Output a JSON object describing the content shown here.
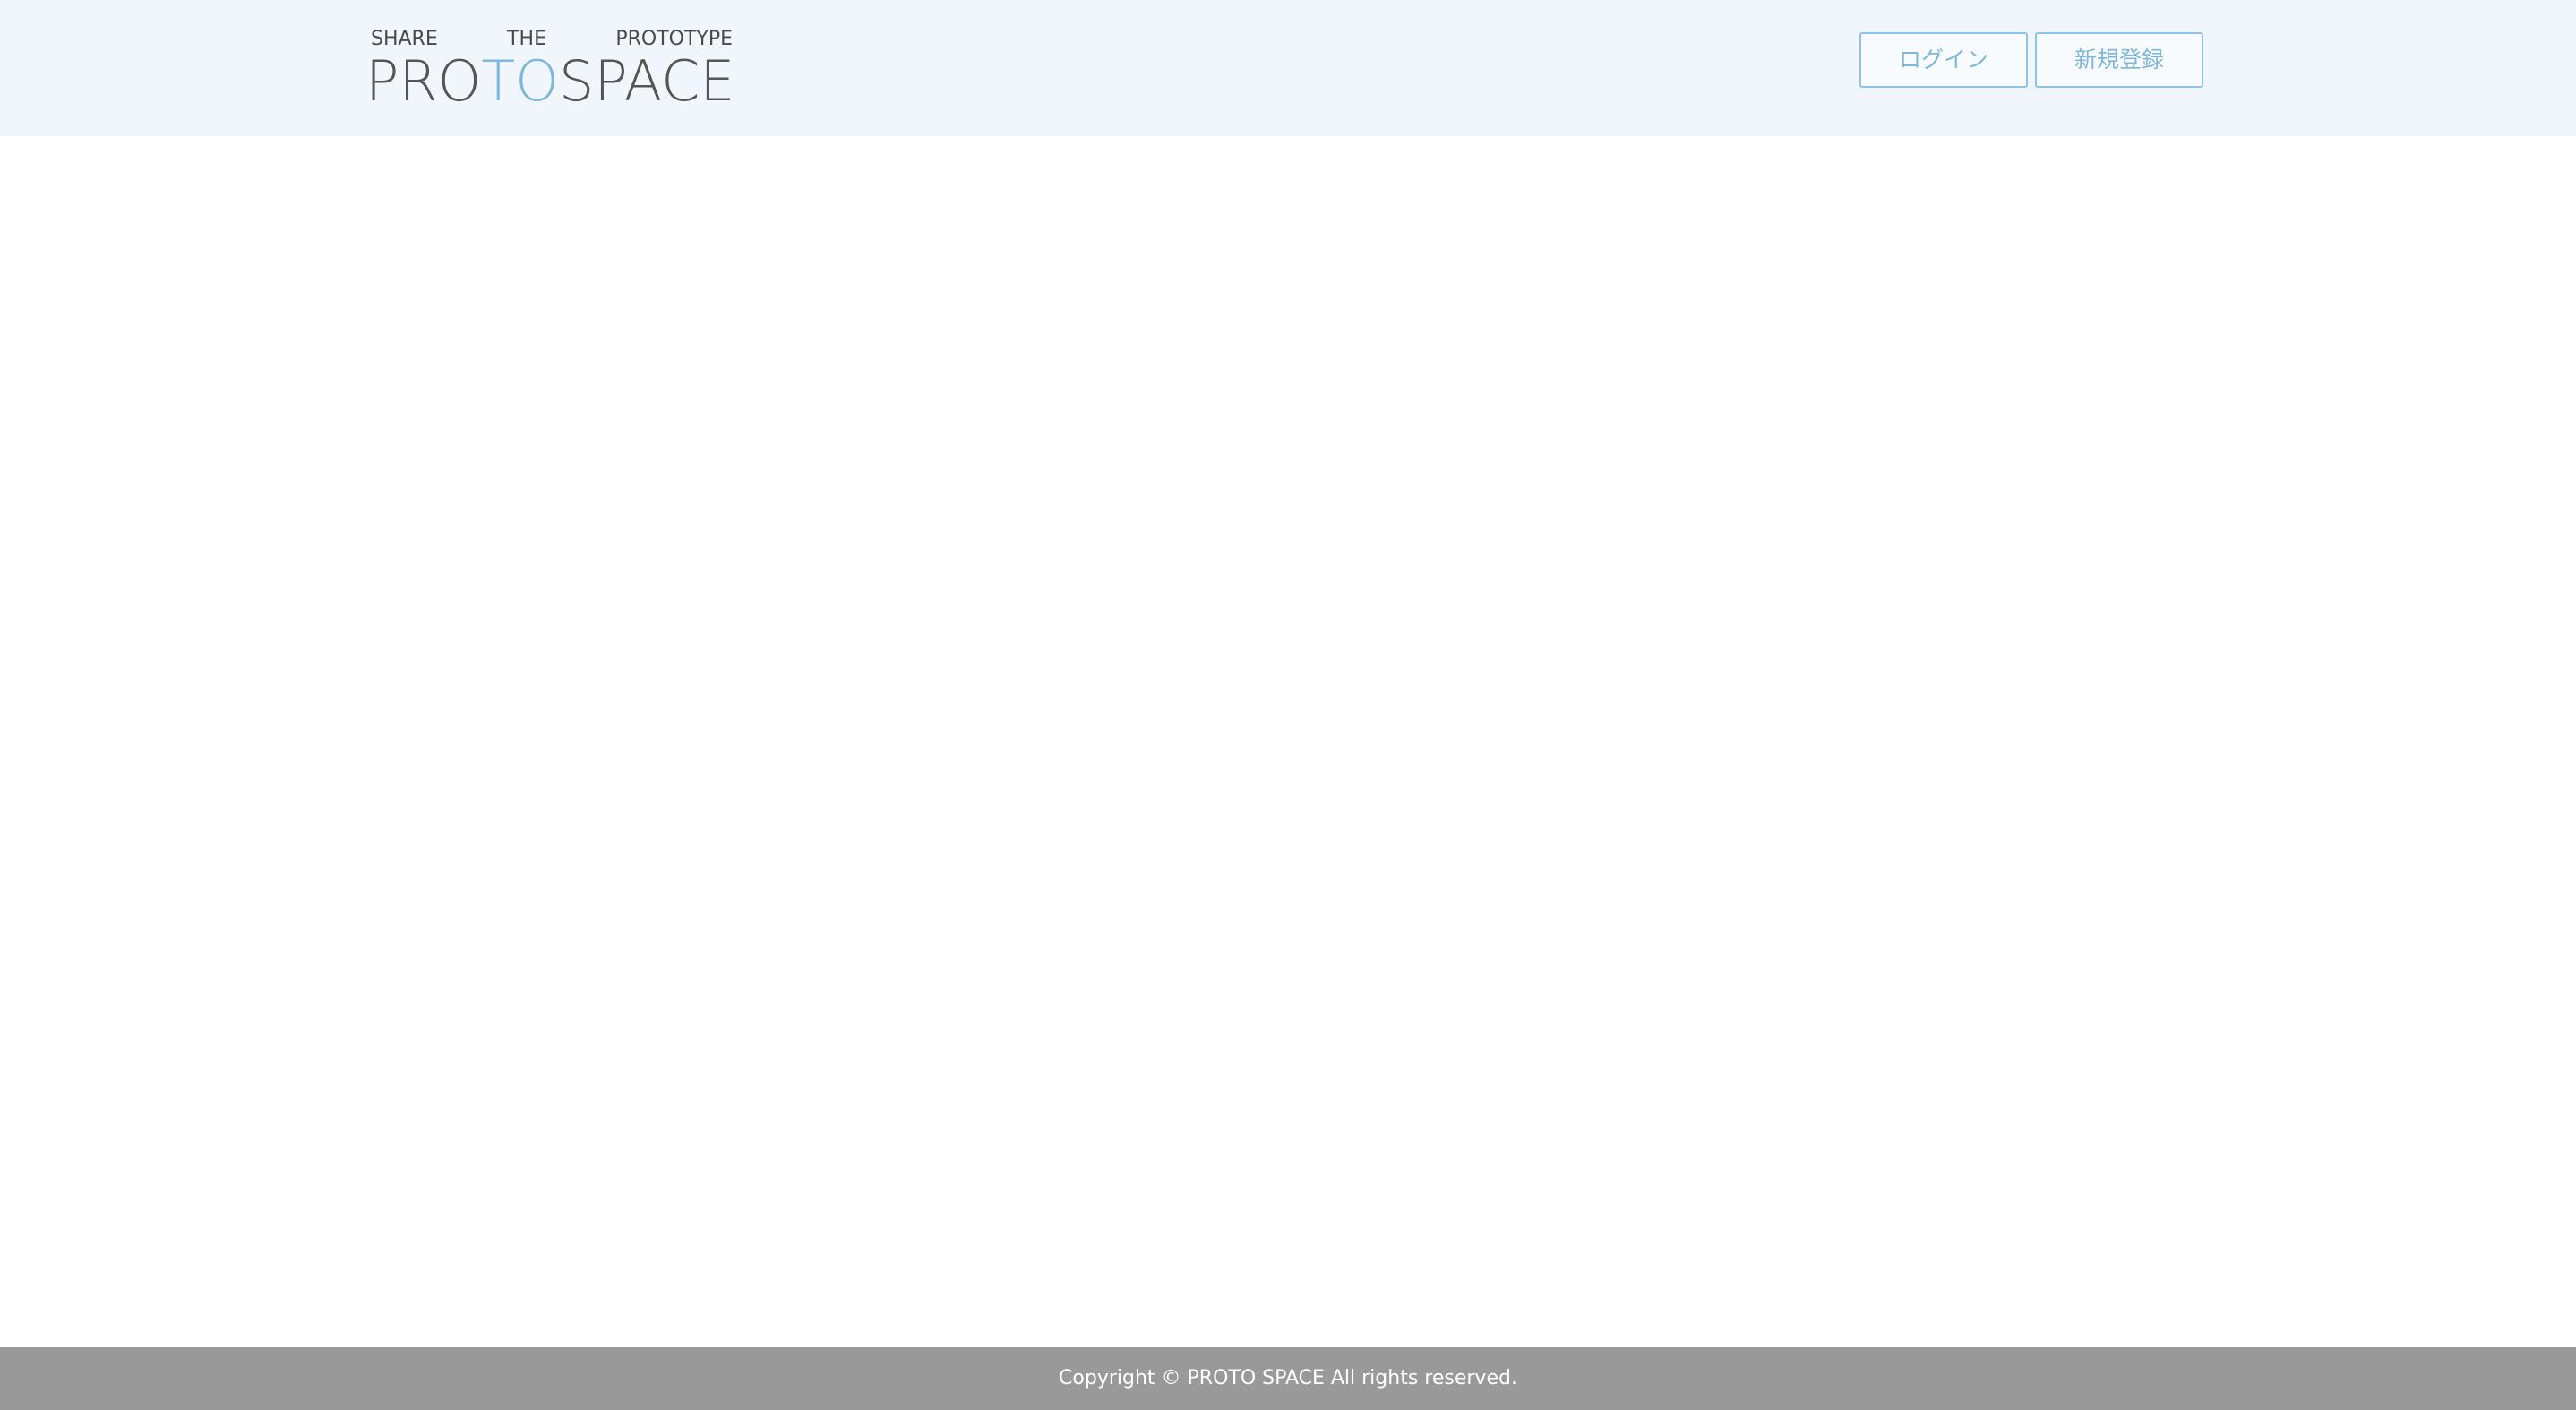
{
  "header": {
    "logo": {
      "tagline": "SHARE THE PROTOTYPE",
      "name_part1": "PRO",
      "name_accent": "TO",
      "name_part2": "SPACE",
      "accent_color": "#7fb7db"
    },
    "login_label": "ログイン",
    "signup_label": "新規登録"
  },
  "footer": {
    "copyright": "Copyright © PROTO SPACE All rights reserved."
  },
  "colors": {
    "header_background": "#f0f6fc",
    "button_accent": "#7fb7db",
    "footer_background": "#999999"
  }
}
